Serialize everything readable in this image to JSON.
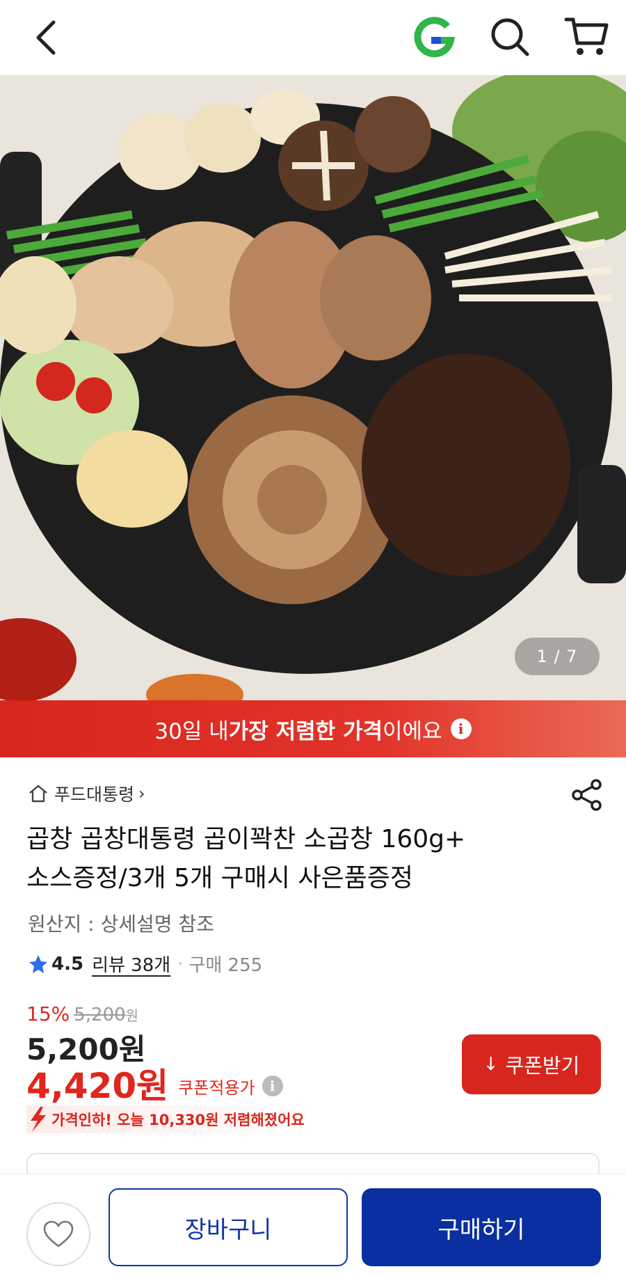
{
  "header": {
    "back_icon": "chevron-left-icon",
    "logo_icon": "gmarket-g-logo",
    "search_icon": "search-icon",
    "cart_icon": "cart-icon"
  },
  "gallery": {
    "counter": "1 / 7"
  },
  "banner": {
    "text_before": "30일 내 ",
    "text_bold": "가장 저렴한 가격",
    "text_after": "이에요",
    "info_glyph": "i"
  },
  "product": {
    "seller": "푸드대통령",
    "seller_chevron": "›",
    "title_line1": "곱창 곱창대통령 곱이꽉찬 소곱창 160g+",
    "title_line2": "소스증정/3개 5개 구매시 사은품증정",
    "origin": "원산지 : 상세설명 참조",
    "rating": "4.5",
    "reviews": "리뷰 38개",
    "separator": "·",
    "purchases": "구매 255"
  },
  "pricing": {
    "discount_percent": "15%",
    "original_price": "5,200",
    "original_unit": "원",
    "price": "5,200원",
    "coupon_price": "4,420원",
    "coupon_label": "쿠폰적용가",
    "info_glyph": "i",
    "coupon_button": "쿠폰받기",
    "coupon_button_icon": "↓",
    "price_drop_note": "가격인하! 오늘 10,330원 저렴해졌어요"
  },
  "bottom_bar": {
    "like_icon": "heart-icon",
    "cart_button": "장바구니",
    "buy_button": "구매하기"
  },
  "colors": {
    "accent_red": "#d8261e",
    "primary_blue": "#0a2fa0",
    "logo_green": "#2fb54a",
    "logo_blue": "#1f4fd8"
  }
}
